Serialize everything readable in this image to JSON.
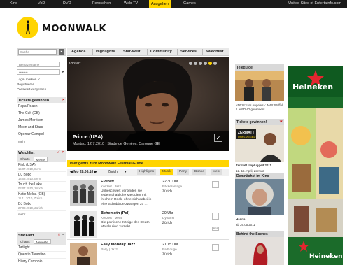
{
  "topnav": {
    "items": [
      "Kino",
      "VoD",
      "DVD",
      "Fernsehen",
      "Web-TV",
      "Ausgehen",
      "Games"
    ],
    "active": "Ausgehen",
    "right": "United Sites of Entertainfo.com"
  },
  "brand": {
    "name": "MOONWALK",
    "accent": "#ffd400"
  },
  "search": {
    "placeholder": "Suche",
    "go_label": "▸"
  },
  "login": {
    "user_placeholder": "Benutzername",
    "pass_placeholder": "••••••••",
    "remember": "Login merken ✓",
    "register": "Registrieren",
    "forgot": "Passwort vergessen"
  },
  "tickets": {
    "heading": "Tickets gewinnen",
    "items": [
      "Papa Roach",
      "The Cult (GB)",
      "James Morrison",
      "Moon and Stars",
      "Openair Gampel"
    ],
    "more": "mehr"
  },
  "watchlist": {
    "heading": "Watchlist",
    "tabs": [
      "Charts",
      "Meine"
    ],
    "items": [
      {
        "title": "Pink (USA)",
        "sub": "15.07.2010, Bern"
      },
      {
        "title": "DJ Bobo",
        "sub": "14.08.2010, Bern"
      },
      {
        "title": "Touch the Lake",
        "sub": "02.07.2010, Zürich"
      },
      {
        "title": "Katie Melua (GB)",
        "sub": "11.11.2010, Zürich"
      },
      {
        "title": "DJ Bobo",
        "sub": "27.08.2010, Zürich"
      }
    ],
    "more": "mehr"
  },
  "staralert": {
    "heading": "StarAlert",
    "tabs": [
      "Charts",
      "Neueste"
    ],
    "items": [
      "Twilight",
      "Quentin Tarantino",
      "Hilary Cernpbio"
    ]
  },
  "maintabs": [
    "Agenda",
    "Highlights",
    "Star-Welt",
    "Community",
    "Services",
    "Watchlist"
  ],
  "hero": {
    "label": "Konzert",
    "title": "Prince (USA)",
    "subtitle": "Montag, 12.7.2010 | Stade de Genève, Carouge GE",
    "check": "✓"
  },
  "festival": {
    "text": "Hier gehts zum Moonwalk Festival-Guide"
  },
  "datebar": {
    "date": "◀ Mo 28.06.10 ▶",
    "city": "Zürich",
    "filters": [
      "Highlights",
      "Musik",
      "Party",
      "Bühne",
      "Mehr"
    ],
    "active_filter": "Musik"
  },
  "events": [
    {
      "title": "Everett",
      "genre": "Konzert | Jazz",
      "desc": "Unbeschwert verbinden sie leidenschaftliche Melodien mit frechem Rock, ohne sich dabei in eine Schublade zwängen zu ...",
      "time": "22.30 Uhr",
      "venue": "Bäckeranlage",
      "city": "Zürich"
    },
    {
      "title": "Behemoth (Pol)",
      "genre": "Konzert | Metal",
      "desc": "Die polnische Könige des Death Metals sind zurück!",
      "time": "20 Uhr",
      "venue": "Dynamo",
      "city": "Zürich",
      "mini": "2010"
    },
    {
      "title": "Easy Monday Jazz",
      "genre": "Party | Jazz",
      "desc": "",
      "time": "21.15 Uhr",
      "venue": "BarRouge",
      "city": "Zürich"
    }
  ],
  "right": {
    "teleguide": {
      "heading": "Teleguide",
      "caption": "«NCIS: Los Angeles»: Jetzt Staffel 1 auf DVD gewinnen!"
    },
    "tickets": {
      "heading": "Tickets gewinnen!",
      "badge_line1": "ZERMATT",
      "badge_line2": "UNPLUGGED",
      "caption_title": "Zermatt Unplugged 2011",
      "caption_sub": "12.-16. April, Zermatt"
    },
    "cinema": {
      "heading": "Demnächst im Kino",
      "caption_title": "Hanna",
      "caption_sub": "ab 26.05.2011"
    },
    "behind": {
      "heading": "Behind the Scenes"
    }
  },
  "ad": {
    "brand": "Heineken",
    "color": "#1b6b2a"
  }
}
